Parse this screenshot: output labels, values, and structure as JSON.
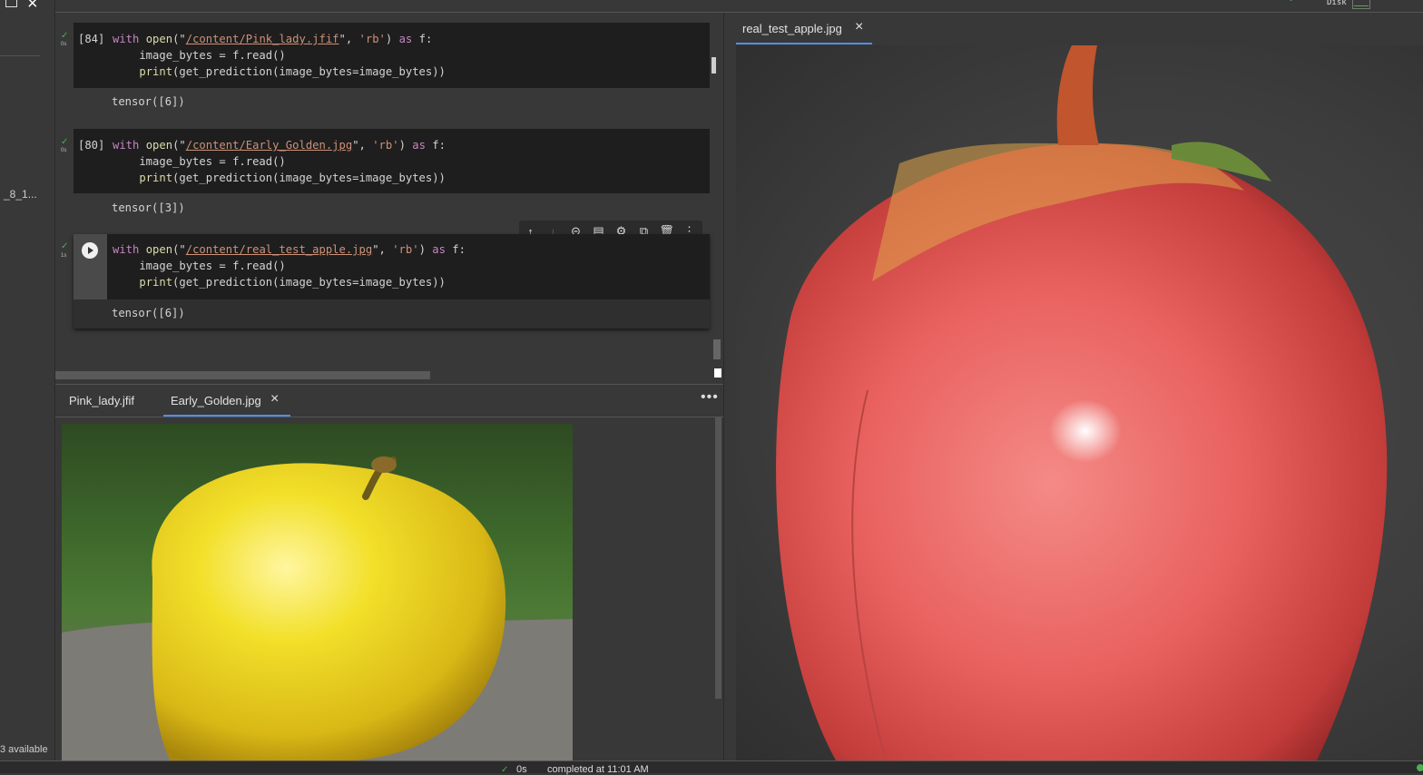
{
  "sidebar": {
    "file_truncated": "_8_1...",
    "disk_available": "3 available"
  },
  "top_bar": {
    "disk_label": "Disk"
  },
  "cells": [
    {
      "exec_count": "[84]",
      "time": "0s",
      "lines": {
        "l1": {
          "kw1": "with",
          "fn": "open",
          "p1": "(\"",
          "path": "/content/Pink_lady.jfif",
          "p2": "\", ",
          "mode": "'rb'",
          "p3": ") ",
          "kw2": "as",
          "p4": " f:"
        },
        "l2": "    image_bytes = f.read()",
        "l3": {
          "fn": "print",
          "rest": "(get_prediction(image_bytes=image_bytes))"
        }
      },
      "output": "tensor([6])"
    },
    {
      "exec_count": "[80]",
      "time": "0s",
      "lines": {
        "l1": {
          "kw1": "with",
          "fn": "open",
          "p1": "(\"",
          "path": "/content/Early_Golden.jpg",
          "p2": "\", ",
          "mode": "'rb'",
          "p3": ") ",
          "kw2": "as",
          "p4": " f:"
        },
        "l2": "    image_bytes = f.read()",
        "l3": {
          "fn": "print",
          "rest": "(get_prediction(image_bytes=image_bytes))"
        }
      },
      "output": "tensor([3])"
    },
    {
      "exec_count": "",
      "time": "1s",
      "lines": {
        "l1": {
          "kw1": "with",
          "fn": "open",
          "p1": "(\"",
          "path": "/content/real_test_apple.jpg",
          "p2": "\", ",
          "mode": "'rb'",
          "p3": ") ",
          "kw2": "as",
          "p4": " f:"
        },
        "l2": "    image_bytes = f.read()",
        "l3": {
          "fn": "print",
          "rest": "(get_prediction(image_bytes=image_bytes))"
        }
      },
      "output": "tensor([6])"
    }
  ],
  "cell_toolbar": {
    "icons": [
      "arrow-up-icon",
      "arrow-down-icon",
      "link-icon",
      "comment-icon",
      "gear-icon",
      "mirror-cell-icon",
      "trash-icon",
      "more-vert-icon"
    ]
  },
  "bottom_viewer": {
    "tabs": [
      {
        "label": "Pink_lady.jfif"
      },
      {
        "label": "Early_Golden.jpg",
        "active": true
      }
    ],
    "image": "yellow-apple-on-grass"
  },
  "right_viewer": {
    "tabs": [
      {
        "label": "real_test_apple.jpg",
        "active": true
      }
    ],
    "image": "red-apple-close-up"
  },
  "status_bar": {
    "duration": "0s",
    "completed": "completed at 11:01 AM"
  },
  "colors": {
    "accent": "#4f8fe8",
    "success": "#4caf50",
    "keyword": "#c586c0",
    "string": "#ce9178",
    "function": "#dcdcaa"
  }
}
